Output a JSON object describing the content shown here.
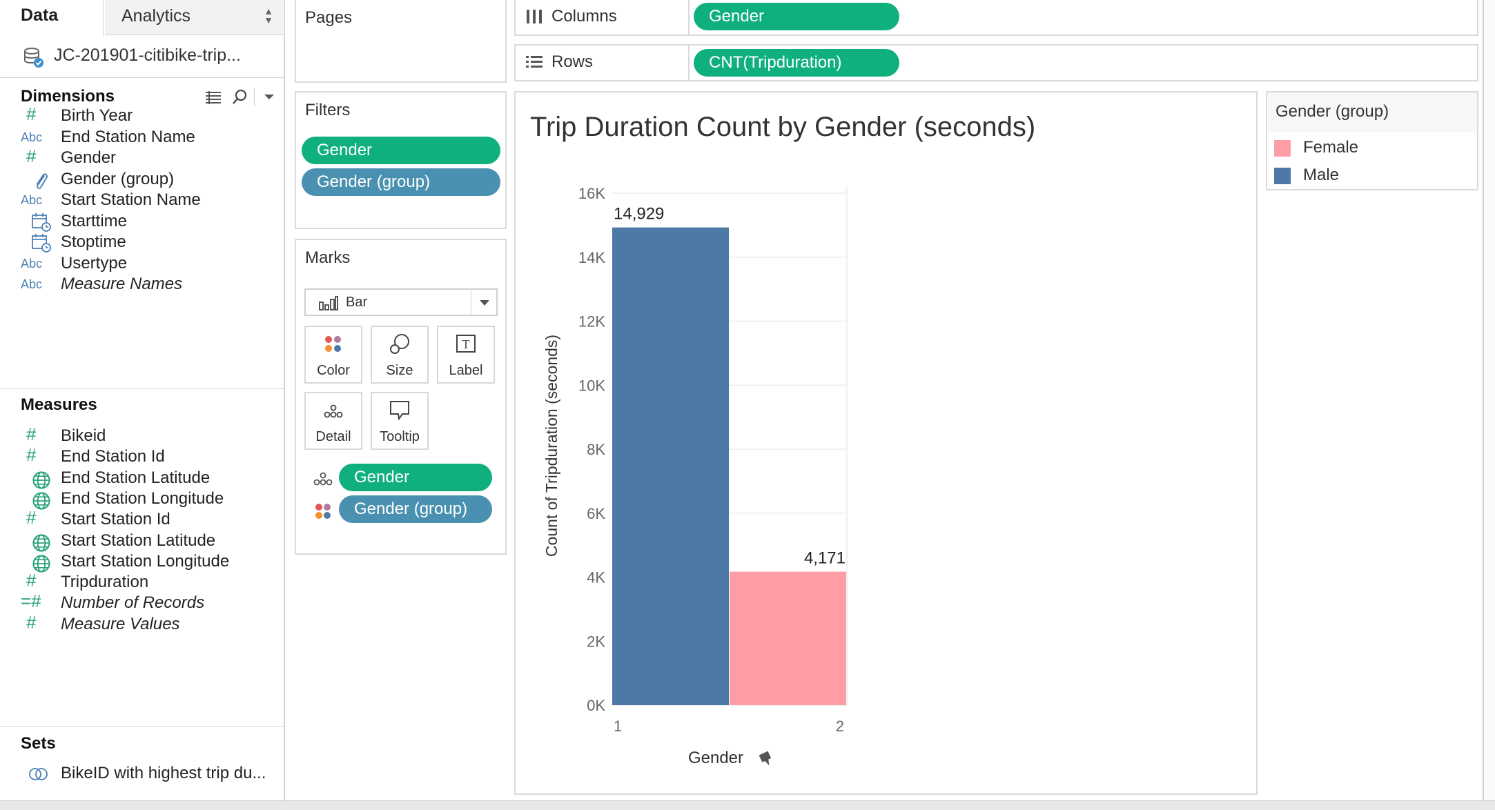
{
  "pane_tabs": {
    "data": "Data",
    "analytics": "Analytics"
  },
  "datasource": {
    "name": "JC-201901-citibike-trip..."
  },
  "dimensions": {
    "title": "Dimensions",
    "items": [
      {
        "label": "Birth Year",
        "icon": "hash-icon"
      },
      {
        "label": "End Station Name",
        "icon": "abc-icon"
      },
      {
        "label": "Gender",
        "icon": "hash-icon"
      },
      {
        "label": "Gender (group)",
        "icon": "paperclip-icon"
      },
      {
        "label": "Start Station Name",
        "icon": "abc-icon"
      },
      {
        "label": "Starttime",
        "icon": "calendar-clock-icon"
      },
      {
        "label": "Stoptime",
        "icon": "calendar-clock-icon"
      },
      {
        "label": "Usertype",
        "icon": "abc-icon"
      },
      {
        "label": "Measure Names",
        "icon": "abc-icon"
      }
    ]
  },
  "measures": {
    "title": "Measures",
    "items": [
      {
        "label": "Bikeid",
        "icon": "hash-icon"
      },
      {
        "label": "End Station Id",
        "icon": "hash-icon"
      },
      {
        "label": "End Station Latitude",
        "icon": "globe-icon"
      },
      {
        "label": "End Station Longitude",
        "icon": "globe-icon"
      },
      {
        "label": "Start Station Id",
        "icon": "hash-icon"
      },
      {
        "label": "Start Station Latitude",
        "icon": "globe-icon"
      },
      {
        "label": "Start Station Longitude",
        "icon": "globe-icon"
      },
      {
        "label": "Tripduration",
        "icon": "hash-icon"
      },
      {
        "label": "Number of Records",
        "icon": "hash-icon"
      },
      {
        "label": "Measure Values",
        "icon": "hash-icon"
      }
    ]
  },
  "sets": {
    "title": "Sets",
    "items": [
      {
        "label": "BikeID with highest trip du...",
        "icon": "set-icon"
      }
    ]
  },
  "pages": {
    "title": "Pages"
  },
  "filters": {
    "title": "Filters",
    "pills": [
      "Gender",
      "Gender (group)"
    ]
  },
  "marks": {
    "title": "Marks",
    "mark_type": "Bar",
    "buttons": [
      "Color",
      "Size",
      "Label",
      "Detail",
      "Tooltip"
    ],
    "pills": [
      "Gender",
      "Gender (group)"
    ]
  },
  "shelves": {
    "columns": {
      "label": "Columns",
      "pill": "Gender"
    },
    "rows": {
      "label": "Rows",
      "pill": "CNT(Tripduration)"
    }
  },
  "legend": {
    "title": "Gender (group)",
    "items": [
      {
        "label": "Female",
        "color": "#ff9da7"
      },
      {
        "label": "Male",
        "color": "#4e79a7"
      }
    ]
  },
  "colors": {
    "pill_green": "#10b07e",
    "pill_blue": "#4a90b0"
  },
  "chart_data": {
    "type": "bar",
    "title": "Trip Duration Count by Gender (seconds)",
    "xlabel": "Gender",
    "ylabel": "Count of Tripduration (seconds)",
    "categories": [
      "1",
      "2"
    ],
    "values": [
      14929,
      4171
    ],
    "value_labels": [
      "14,929",
      "4,171"
    ],
    "bar_colors": [
      "#4e79a7",
      "#ff9da7"
    ],
    "ylim": [
      0,
      16000
    ],
    "y_ticks": [
      0,
      2000,
      4000,
      6000,
      8000,
      10000,
      12000,
      14000,
      16000
    ],
    "y_tick_labels": [
      "0K",
      "2K",
      "4K",
      "6K",
      "8K",
      "10K",
      "12K",
      "14K",
      "16K"
    ],
    "grid": true
  }
}
